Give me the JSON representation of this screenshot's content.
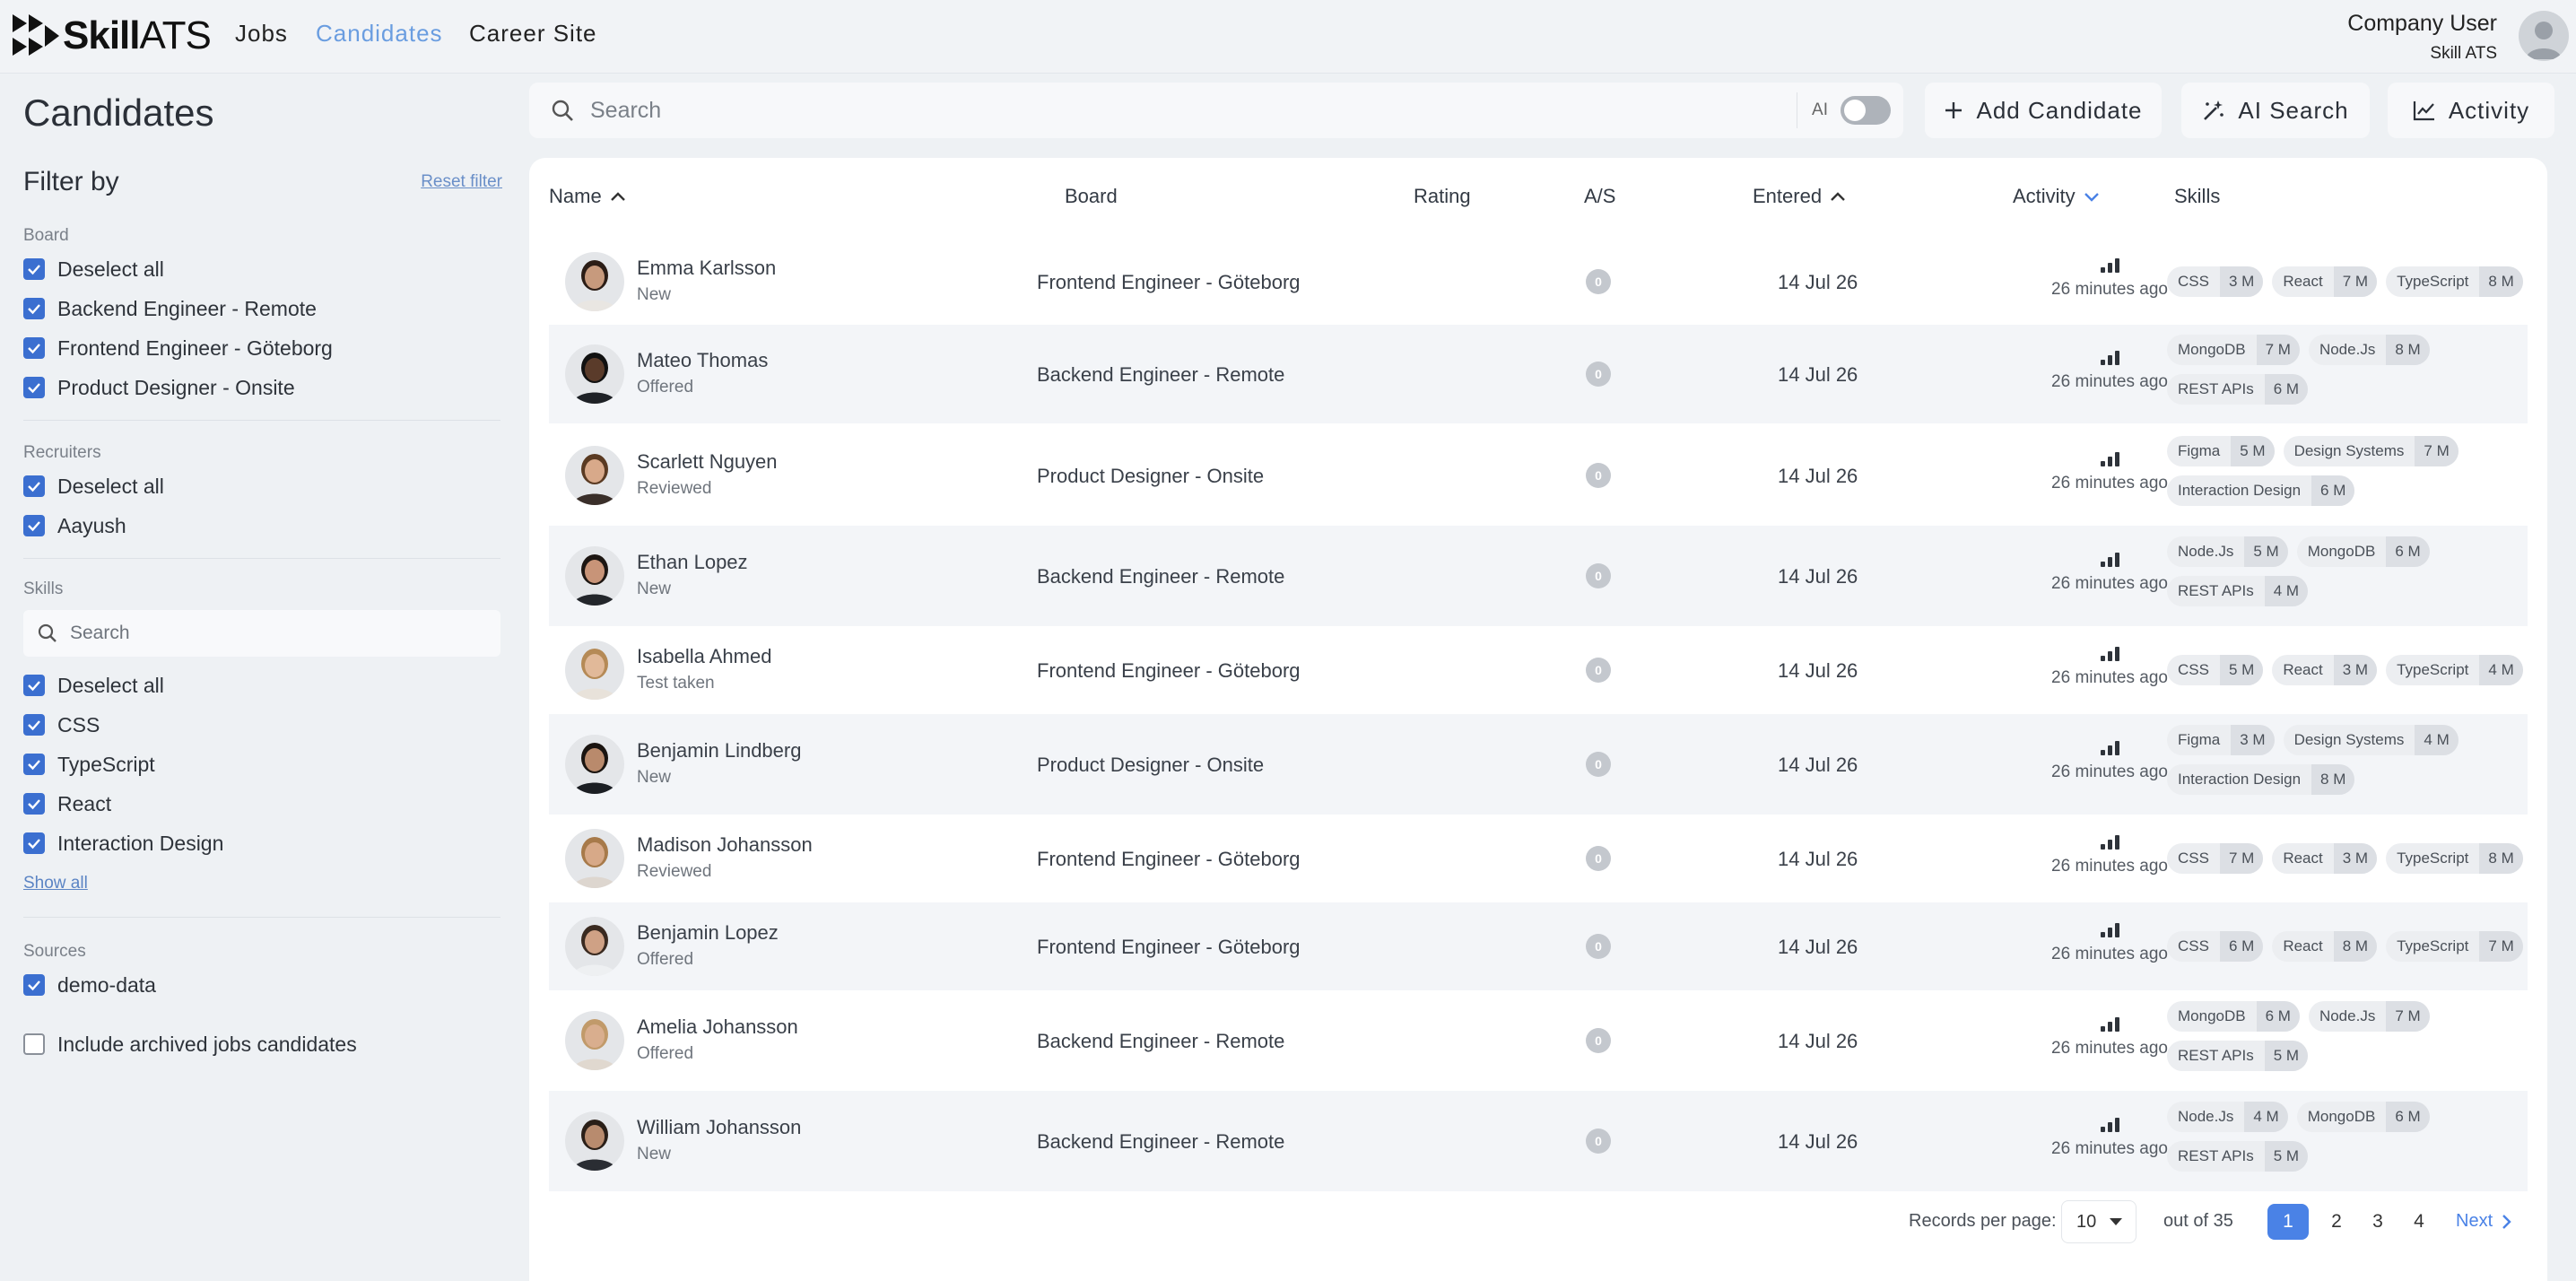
{
  "app": {
    "logo_bold": "Skill",
    "logo_light": "ATS"
  },
  "nav": [
    {
      "label": "Jobs",
      "active": false
    },
    {
      "label": "Candidates",
      "active": true
    },
    {
      "label": "Career Site",
      "active": false
    }
  ],
  "user": {
    "name": "Company User",
    "company": "Skill ATS"
  },
  "page_title": "Candidates",
  "sidebar": {
    "filter_title": "Filter by",
    "reset_label": "Reset filter",
    "board_label": "Board",
    "board_items": [
      "Deselect all",
      "Backend Engineer - Remote",
      "Frontend Engineer - Göteborg",
      "Product Designer - Onsite"
    ],
    "recruiters_label": "Recruiters",
    "recruiter_items": [
      "Deselect all",
      "Aayush"
    ],
    "skills_label": "Skills",
    "skills_search_placeholder": "Search",
    "skill_items": [
      "Deselect all",
      "CSS",
      "TypeScript",
      "React",
      "Interaction Design"
    ],
    "show_all": "Show all",
    "sources_label": "Sources",
    "source_items": [
      "demo-data"
    ],
    "archived_label": "Include archived jobs candidates"
  },
  "toolbar": {
    "search_placeholder": "Search",
    "ai_label": "AI",
    "add_candidate": "Add Candidate",
    "ai_search": "AI Search",
    "activity": "Activity"
  },
  "table": {
    "headers": {
      "name": "Name",
      "board": "Board",
      "rating": "Rating",
      "as": "A/S",
      "entered": "Entered",
      "activity": "Activity",
      "skills": "Skills"
    },
    "rows": [
      {
        "name": "Emma Karlsson",
        "status": "New",
        "board": "Frontend Engineer - Göteborg",
        "as": "0",
        "entered": "14 Jul 26",
        "activity": "26 minutes ago",
        "skills": [
          {
            "n": "CSS",
            "l": "3 M"
          },
          {
            "n": "React",
            "l": "7 M"
          },
          {
            "n": "TypeScript",
            "l": "8 M"
          }
        ]
      },
      {
        "name": "Mateo Thomas",
        "status": "Offered",
        "board": "Backend Engineer - Remote",
        "as": "0",
        "entered": "14 Jul 26",
        "activity": "26 minutes ago",
        "skills": [
          {
            "n": "MongoDB",
            "l": "7 M"
          },
          {
            "n": "Node.Js",
            "l": "8 M"
          },
          {
            "n": "REST APIs",
            "l": "6 M"
          }
        ]
      },
      {
        "name": "Scarlett Nguyen",
        "status": "Reviewed",
        "board": "Product Designer - Onsite",
        "as": "0",
        "entered": "14 Jul 26",
        "activity": "26 minutes ago",
        "skills": [
          {
            "n": "Figma",
            "l": "5 M"
          },
          {
            "n": "Design Systems",
            "l": "7 M"
          },
          {
            "n": "Interaction Design",
            "l": "6 M"
          }
        ]
      },
      {
        "name": "Ethan Lopez",
        "status": "New",
        "board": "Backend Engineer - Remote",
        "as": "0",
        "entered": "14 Jul 26",
        "activity": "26 minutes ago",
        "skills": [
          {
            "n": "Node.Js",
            "l": "5 M"
          },
          {
            "n": "MongoDB",
            "l": "6 M"
          },
          {
            "n": "REST APIs",
            "l": "4 M"
          }
        ]
      },
      {
        "name": "Isabella Ahmed",
        "status": "Test taken",
        "board": "Frontend Engineer - Göteborg",
        "as": "0",
        "entered": "14 Jul 26",
        "activity": "26 minutes ago",
        "skills": [
          {
            "n": "CSS",
            "l": "5 M"
          },
          {
            "n": "React",
            "l": "3 M"
          },
          {
            "n": "TypeScript",
            "l": "4 M"
          }
        ]
      },
      {
        "name": "Benjamin Lindberg",
        "status": "New",
        "board": "Product Designer - Onsite",
        "as": "0",
        "entered": "14 Jul 26",
        "activity": "26 minutes ago",
        "skills": [
          {
            "n": "Figma",
            "l": "3 M"
          },
          {
            "n": "Design Systems",
            "l": "4 M"
          },
          {
            "n": "Interaction Design",
            "l": "8 M"
          }
        ]
      },
      {
        "name": "Madison Johansson",
        "status": "Reviewed",
        "board": "Frontend Engineer - Göteborg",
        "as": "0",
        "entered": "14 Jul 26",
        "activity": "26 minutes ago",
        "skills": [
          {
            "n": "CSS",
            "l": "7 M"
          },
          {
            "n": "React",
            "l": "3 M"
          },
          {
            "n": "TypeScript",
            "l": "8 M"
          }
        ]
      },
      {
        "name": "Benjamin Lopez",
        "status": "Offered",
        "board": "Frontend Engineer - Göteborg",
        "as": "0",
        "entered": "14 Jul 26",
        "activity": "26 minutes ago",
        "skills": [
          {
            "n": "CSS",
            "l": "6 M"
          },
          {
            "n": "React",
            "l": "8 M"
          },
          {
            "n": "TypeScript",
            "l": "7 M"
          }
        ]
      },
      {
        "name": "Amelia Johansson",
        "status": "Offered",
        "board": "Backend Engineer - Remote",
        "as": "0",
        "entered": "14 Jul 26",
        "activity": "26 minutes ago",
        "skills": [
          {
            "n": "MongoDB",
            "l": "6 M"
          },
          {
            "n": "Node.Js",
            "l": "7 M"
          },
          {
            "n": "REST APIs",
            "l": "5 M"
          }
        ]
      },
      {
        "name": "William Johansson",
        "status": "New",
        "board": "Backend Engineer - Remote",
        "as": "0",
        "entered": "14 Jul 26",
        "activity": "26 minutes ago",
        "skills": [
          {
            "n": "Node.Js",
            "l": "4 M"
          },
          {
            "n": "MongoDB",
            "l": "6 M"
          },
          {
            "n": "REST APIs",
            "l": "5 M"
          }
        ]
      }
    ]
  },
  "pagination": {
    "records_label": "Records per page:",
    "per_page": "10",
    "out_of": "out of 35",
    "pages": [
      "1",
      "2",
      "3",
      "4"
    ],
    "next": "Next"
  },
  "colors": {
    "accent": "#4a82e6",
    "nav_active": "#6a9de0",
    "checkbox": "#3b6fd0"
  }
}
